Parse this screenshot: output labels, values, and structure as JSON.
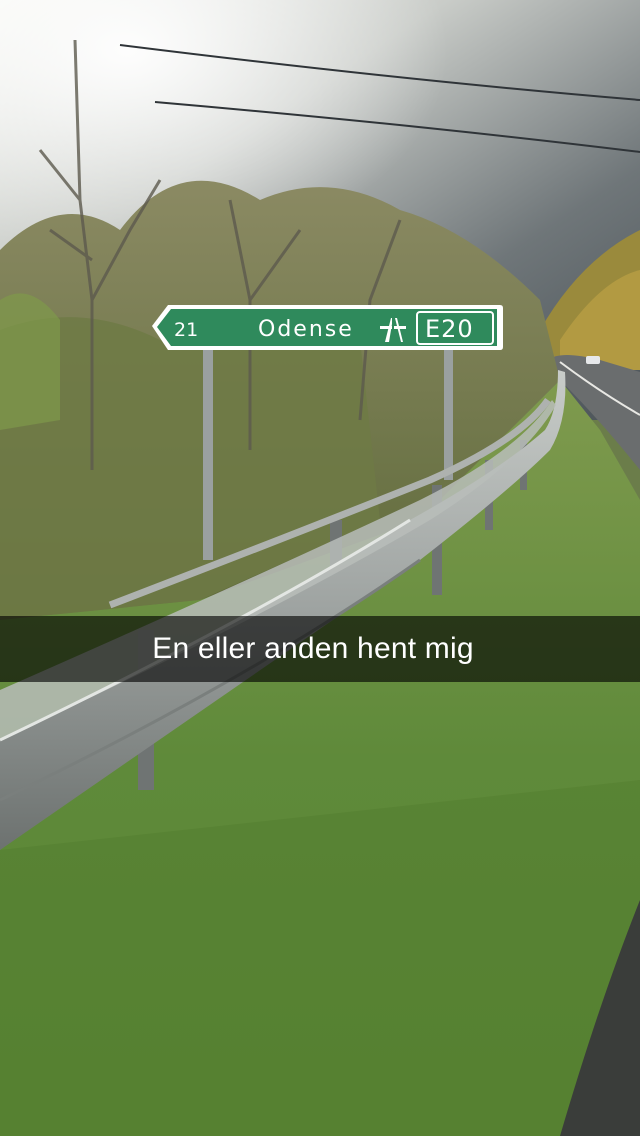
{
  "snap": {
    "caption": "En eller anden hent mig"
  },
  "road_sign": {
    "exit_number": "21",
    "destination": "Odense",
    "route": "E20",
    "arrow_direction": "left",
    "symbol": "motorway-icon",
    "color": "#2f8a5c",
    "text_color": "#ffffff"
  }
}
